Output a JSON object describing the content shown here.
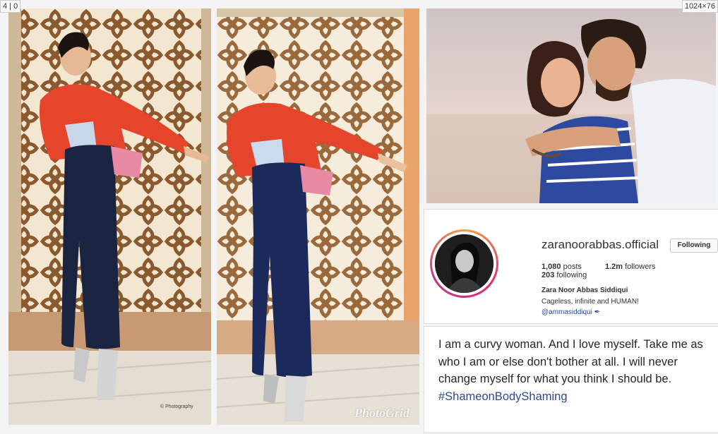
{
  "corner_left": "4 | 0",
  "corner_right": "1024×76",
  "photos": {
    "left_credit": "© Photography",
    "middle_watermark": "PhotoGrid"
  },
  "profile": {
    "username": "zaranoorabbas.official",
    "follow_label": "Following",
    "posts_count": "1,080",
    "posts_label": "posts",
    "followers_count": "1.2m",
    "followers_label": "followers",
    "following_count": "203",
    "following_label": "following",
    "full_name": "Zara Noor Abbas Siddiqui",
    "bio": "Cageless, infinite and HUMAN!",
    "mention": "@ammasiddiqui ✒"
  },
  "quote": {
    "text": "I am a curvy woman. And I love myself. Take me as who I am or else don't bother at all. I will never change myself for what you think I should be.",
    "hashtag": "#ShameonBodyShaming"
  },
  "colors": {
    "lattice": "#8a5a2e",
    "wall": "#e6d8c2",
    "jacket": "#e5452a",
    "jumpsuit": "#1a2440",
    "link": "#2b4a8f"
  }
}
